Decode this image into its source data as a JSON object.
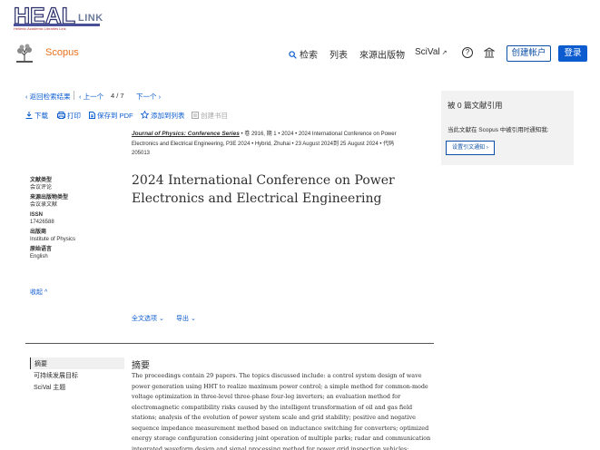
{
  "banner": {
    "brand_main": "HEAL",
    "brand_link": "LINK",
    "brand_sub": "Hellenic Academic Libraries Link"
  },
  "nav": {
    "brand": "Scopus",
    "search": "检索",
    "list": "列表",
    "sources": "來源出版物",
    "scival": "SciVal",
    "scival_ext": "↗",
    "help": "?",
    "create_account": "创建帐户",
    "login": "登录"
  },
  "pager": {
    "back": "‹ 返回检索结果",
    "prev": "‹ 上一个",
    "page": "4  /  7",
    "next": "下一个 ›"
  },
  "actions": {
    "download": "下载",
    "print": "打印",
    "save_pdf": "保存到 PDF",
    "add_list": "添加到列表",
    "create_bib": "创建书目"
  },
  "source": {
    "journal": "Journal of Physics: Conference Series",
    "line1": " •  卷 2916, 期 1  •  2024  •  2024 International Conference on Power",
    "line2": "Electronics and Electrical Engineering, P3E 2024  •  Hybrid, Zhuhai  •  23 August 2024到 25 August 2024  •  代码",
    "line3": "205013"
  },
  "title": "2024 International Conference on Power Electronics and Electrical Engineering",
  "meta": {
    "doc_type_label": "文献类型",
    "doc_type": "会议评论",
    "source_type_label": "来源出版物类型",
    "source_type": "会议录文献",
    "issn_label": "ISSN",
    "issn": "17426588",
    "publisher_label": "出版商",
    "publisher": "Institute of Physics",
    "orig_lang_label": "原始语言",
    "orig_lang": "English",
    "collapse": "收起 ^"
  },
  "options": {
    "full_text": "全文选项  ⌄",
    "export": "导出  ⌄"
  },
  "side_tabs": [
    "摘要",
    "可持续发展目标",
    "SciVal 主题"
  ],
  "abstract": {
    "heading": "摘要",
    "text": "The proceedings contain 29 papers. The topics discussed include: a control system design of wave power generation using HHT to realize maximum power control; a simple method for common-mode voltage optimization in three-level three-phase four-leg inverters; an evaluation method for electromagnetic compatibility risks caused by the intelligent transformation of oil and gas field stations; analysis of the evolution of power system scale and grid stability; positive and negative sequence impedance measurement method based on inductance switching for converters; optimized energy storage configuration considering joint operation of multiple parks; radar and communication integrated waveform design and signal processing method for power grid inspection vehicles;"
  },
  "cite_panel": {
    "title": "被 0 篇文献引用",
    "note": "当此文献在 Scopus 中被引用时通知我:",
    "button": "设置引文通知 ›"
  }
}
